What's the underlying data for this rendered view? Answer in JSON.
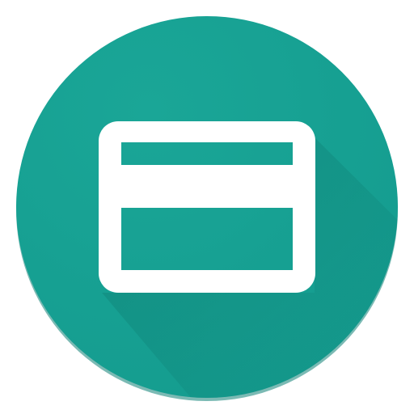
{
  "icon": {
    "name": "credit-card-icon",
    "colors": {
      "circle": "#149C8F",
      "circle_highlight": "#1AA697",
      "long_shadow": "#0E7F74",
      "bottom_rim": "#0F8177",
      "glyph": "#FFFFFF"
    }
  }
}
